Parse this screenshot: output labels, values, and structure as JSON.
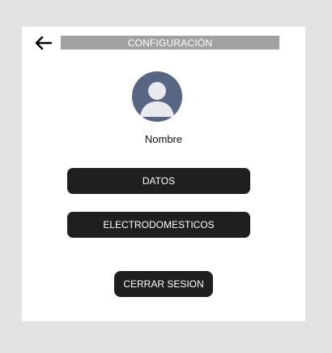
{
  "header": {
    "title": "CONFIGURACIÓN",
    "back_icon": "arrow-left-icon"
  },
  "profile": {
    "avatar_icon": "user-avatar-icon",
    "avatar_color": "#566683",
    "name": "Nombre"
  },
  "buttons": {
    "datos": "DATOS",
    "electrodomesticos": "ELECTRODOMESTICOS",
    "cerrar_sesion": "CERRAR SESION"
  },
  "colors": {
    "background": "#e3e3e3",
    "card": "#ffffff",
    "title_bar": "#a1a1a1",
    "button": "#1f1f1f"
  }
}
